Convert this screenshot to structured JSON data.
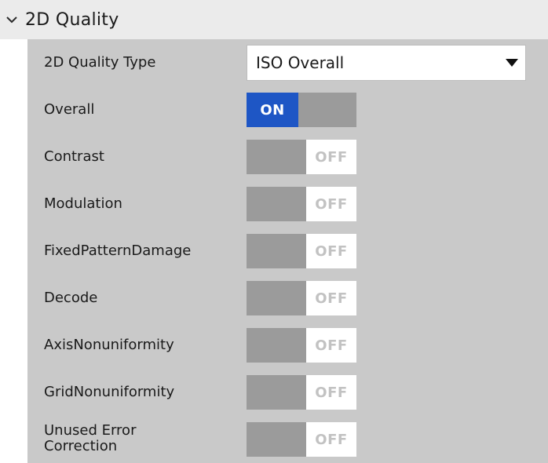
{
  "section": {
    "title": "2D Quality",
    "expand_icon": "chevron-down-icon"
  },
  "quality_type": {
    "label": "2D Quality Type",
    "value": "ISO Overall",
    "dropdown_icon": "triangle-down-icon"
  },
  "toggle_text": {
    "on": "ON",
    "off": "OFF"
  },
  "rows": [
    {
      "label": "Overall",
      "state": "ON"
    },
    {
      "label": "Contrast",
      "state": "OFF"
    },
    {
      "label": "Modulation",
      "state": "OFF"
    },
    {
      "label": "FixedPatternDamage",
      "state": "OFF"
    },
    {
      "label": "Decode",
      "state": "OFF"
    },
    {
      "label": "AxisNonuniformity",
      "state": "OFF"
    },
    {
      "label": "GridNonuniformity",
      "state": "OFF"
    },
    {
      "label": "Unused Error Correction",
      "state": "OFF"
    }
  ],
  "colors": {
    "on_blue": "#1e56c5",
    "panel_gray": "#c9c9c9",
    "header_gray": "#ebebeb",
    "knob_gray": "#9b9b9b"
  }
}
